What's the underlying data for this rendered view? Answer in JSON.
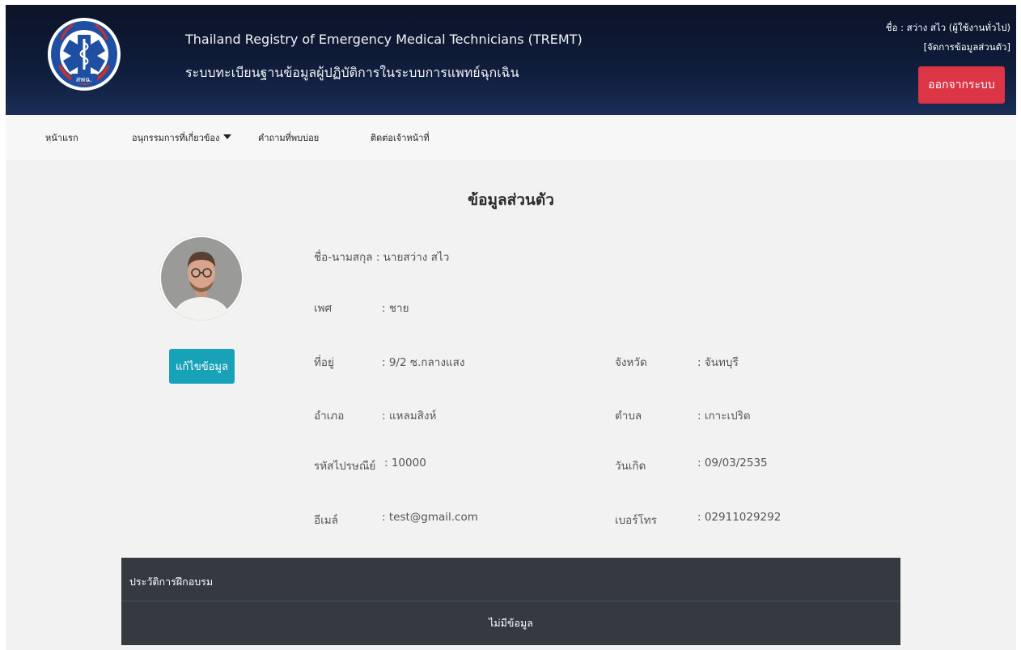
{
  "header": {
    "title_en": "Thailand Registry of Emergency Medical Technicians (TREMT)",
    "title_th": "ระบบทะเบียนฐานข้อมูลผู้ปฏิบัติการในระบบการแพทย์ฉุกเฉิน",
    "logo_text": "สพฉ.",
    "user_line": "ชื่อ : สว่าง สไว (ผู้ใช้งานทั่วไป)",
    "manage_link": "[จัดการข้อมูลส่วนตัว]",
    "logout_label": "ออกจากระบบ"
  },
  "nav": {
    "items": [
      {
        "label": "หน้าแรก"
      },
      {
        "label": "อนุกรรมการที่เกี่ยวข้อง"
      },
      {
        "label": "คำถามที่พบบ่อย"
      },
      {
        "label": "ติดต่อเจ้าหน้าที่"
      }
    ]
  },
  "profile": {
    "title": "ข้อมูลส่วนตัว",
    "edit_label": "แก้ไขข้อมูล",
    "fullname_label": "ชื่อ-นามสกุล : นายสว่าง สไว",
    "fields": {
      "gender": {
        "label": "เพศ",
        "value": ": ชาย"
      },
      "address": {
        "label": "ที่อยู่",
        "value": ": 9/2 ซ.กลางแสง"
      },
      "province": {
        "label": "จังหวัด",
        "value": ": จันทบุรี"
      },
      "district": {
        "label": "อำเภอ",
        "value": ": แหลมสิงห์"
      },
      "subdistrict": {
        "label": "ตำบล",
        "value": ": เกาะเปริด"
      },
      "postcode": {
        "label": "รหัสไปรษณีย์",
        "value": ": 10000"
      },
      "birthdate": {
        "label": "วันเกิด",
        "value": ": 09/03/2535"
      },
      "email": {
        "label": "อีเมล์",
        "value": ": test@gmail.com"
      },
      "phone": {
        "label": "เบอร์โทร",
        "value": ": 02911029292"
      }
    }
  },
  "training": {
    "title": "ประวัติการฝึกอบรม",
    "empty_text": "ไม่มีข้อมูล"
  },
  "colors": {
    "header_bg": "#0f1c3a",
    "logout": "#dc3545",
    "edit": "#17a2b8",
    "table_bg": "#343a40"
  }
}
